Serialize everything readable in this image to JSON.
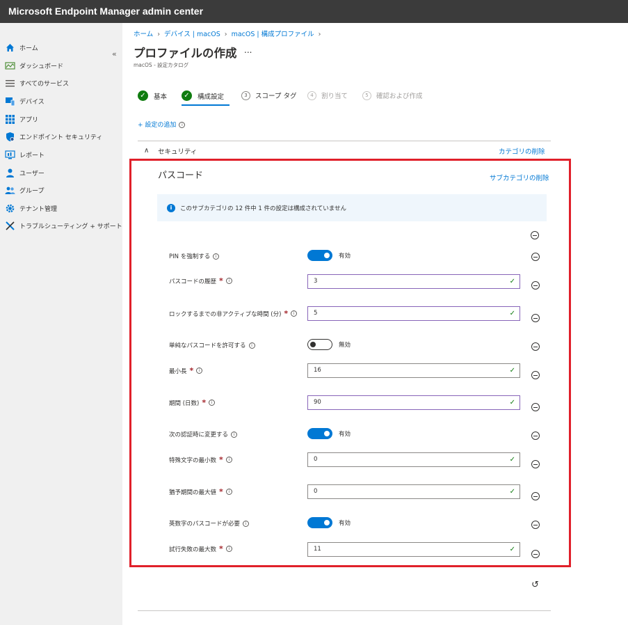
{
  "app": {
    "title": "Microsoft Endpoint Manager admin center"
  },
  "sidebar": {
    "collapse_glyph": "«",
    "items": [
      {
        "label": "ホーム",
        "icon": "home-icon"
      },
      {
        "label": "ダッシュボード",
        "icon": "dashboard-icon"
      },
      {
        "label": "すべてのサービス",
        "icon": "list-icon"
      },
      {
        "label": "デバイス",
        "icon": "devices-icon"
      },
      {
        "label": "アプリ",
        "icon": "apps-grid-icon"
      },
      {
        "label": "エンドポイント セキュリティ",
        "icon": "shield-icon"
      },
      {
        "label": "レポート",
        "icon": "report-icon"
      },
      {
        "label": "ユーザー",
        "icon": "user-icon"
      },
      {
        "label": "グループ",
        "icon": "group-icon"
      },
      {
        "label": "テナント管理",
        "icon": "gear-icon"
      },
      {
        "label": "トラブルシューティング + サポート",
        "icon": "tools-icon"
      }
    ]
  },
  "breadcrumb": [
    "ホーム",
    "デバイス | macOS",
    "macOS | 構成プロファイル"
  ],
  "page": {
    "title": "プロファイルの作成",
    "more": "...",
    "subtitle": "macOS - 設定カタログ"
  },
  "wizard": {
    "steps": [
      {
        "label": "基本",
        "state": "done"
      },
      {
        "label": "構成設定",
        "state": "done"
      },
      {
        "num": "3",
        "label": "スコープ タグ",
        "state": "pending"
      },
      {
        "num": "4",
        "label": "割り当て",
        "state": "disabled"
      },
      {
        "num": "5",
        "label": "確認および作成",
        "state": "disabled"
      }
    ]
  },
  "add_setting": "+ 設定の追加",
  "category": {
    "label": "セキュリティ",
    "delete": "カテゴリの削除"
  },
  "subcategory": {
    "title": "パスコード",
    "delete": "サブカテゴリの削除",
    "banner": "このサブカテゴリの 12 件中 1 件の設定は構成されていません"
  },
  "settings": [
    {
      "label": "PIN を強制する",
      "type": "toggle",
      "value": "有効",
      "on": true
    },
    {
      "label": "パスコードの履歴",
      "required": true,
      "type": "text",
      "value": "3",
      "focus": true
    },
    {
      "label": "ロックするまでの非アクティブな時間 (分)",
      "required": true,
      "type": "text",
      "value": "5",
      "focus": true
    },
    {
      "label": "単純なパスコードを許可する",
      "type": "toggle",
      "value": "無効",
      "on": false
    },
    {
      "label": "最小長",
      "required": true,
      "type": "text",
      "value": "16"
    },
    {
      "label": "期間 (日数)",
      "required": true,
      "type": "text",
      "value": "90",
      "focus": true
    },
    {
      "label": "次の認証時に変更する",
      "type": "toggle",
      "value": "有効",
      "on": true
    },
    {
      "label": "特殊文字の最小数",
      "required": true,
      "type": "text",
      "value": "0"
    },
    {
      "label": "猶予期間の最大値",
      "required": true,
      "type": "text",
      "value": "0"
    },
    {
      "label": "英数字のパスコードが必要",
      "type": "toggle",
      "value": "有効",
      "on": true
    },
    {
      "label": "試行失敗の最大数",
      "required": true,
      "type": "text",
      "value": "11"
    }
  ],
  "glyphs": {
    "info": "i",
    "check": "✓",
    "required": "*",
    "undo": "↺",
    "chevron_up": "∧",
    "step_done": "✓",
    "info_banner": "i"
  }
}
